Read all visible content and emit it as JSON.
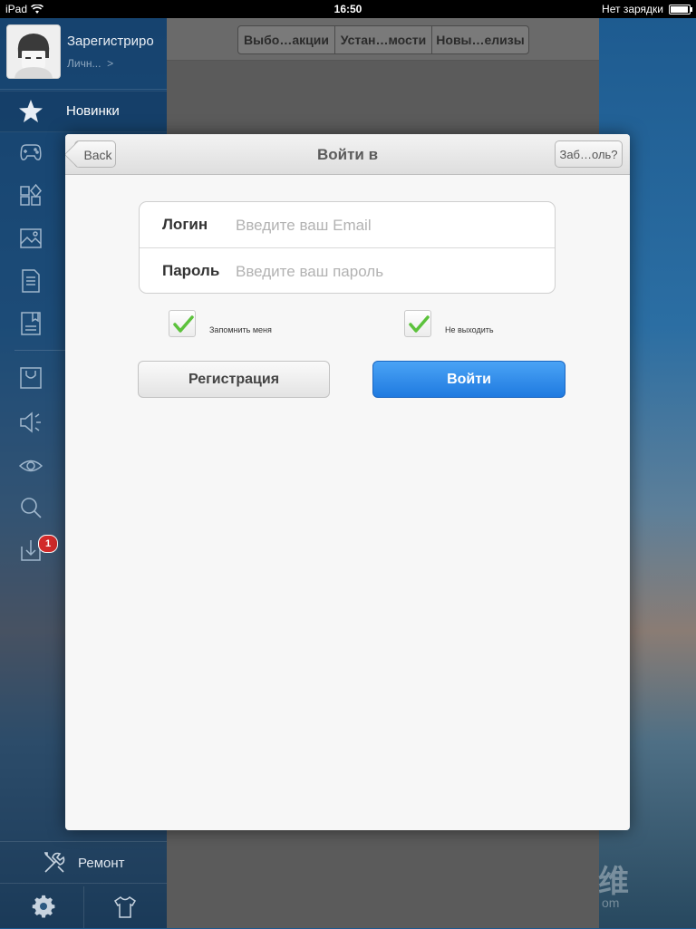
{
  "status_bar": {
    "device": "iPad",
    "time": "16:50",
    "charging": "Нет зарядки"
  },
  "sidebar": {
    "profile_name": "Зарегистриро",
    "profile_link": "Личн...",
    "profile_chevron": ">",
    "active_item": "Новинки",
    "badge_count": "1",
    "repair_label": "Ремонт"
  },
  "background_panel": {
    "segments": [
      "Выбо…акции",
      "Устан…мости",
      "Новы…елизы"
    ]
  },
  "modal": {
    "title": "Войти в",
    "back_label": "Back",
    "forgot_label": "Заб…оль?",
    "login_label": "Логин",
    "login_placeholder": "Введите ваш Email",
    "password_label": "Пароль",
    "password_placeholder": "Введите ваш пароль",
    "remember_label": "Запомнить меня",
    "stay_label": "Не выходить",
    "register_button": "Регистрация",
    "login_button": "Войти"
  },
  "colors": {
    "login_button": "#2388ea",
    "check_green": "#5cc23c",
    "badge_red": "#d22a2a"
  }
}
